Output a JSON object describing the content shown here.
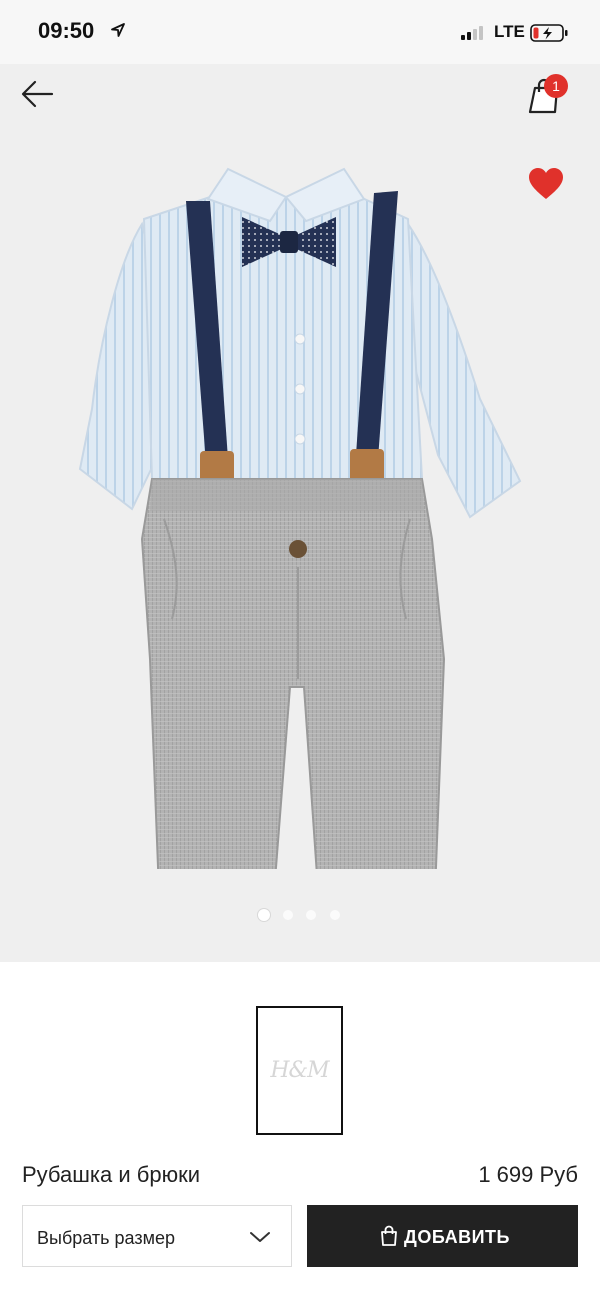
{
  "status_bar": {
    "time": "09:50",
    "network": "LTE"
  },
  "header": {
    "cart_count": "1",
    "back_icon": "arrow-left-icon",
    "cart_icon": "shopping-bag-icon",
    "favorite_icon": "heart-icon"
  },
  "gallery": {
    "image_count": 4,
    "active_index": 0
  },
  "thumbnail": {
    "brand_logo": "H&M"
  },
  "product": {
    "name": "Рубашка и брюки",
    "price": "1 699 Руб"
  },
  "actions": {
    "size_label": "Выбрать размер",
    "add_label": "ДОБАВИТЬ"
  },
  "colors": {
    "accent": "#e0312b",
    "button": "#222222",
    "image_background": "#efefef"
  }
}
